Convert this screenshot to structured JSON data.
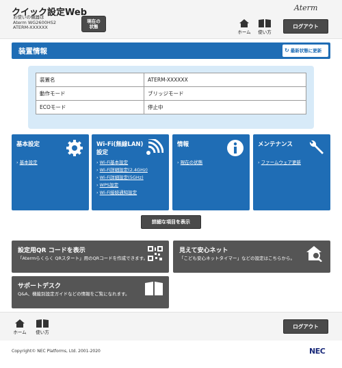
{
  "header": {
    "title": "クイック設定Web",
    "device_label": "お使いの機器は",
    "device_model": "Aterm WG2600HS2",
    "device_name": "ATERM-XXXXXX",
    "status_button": "現在の\n状態",
    "home_label": "ホーム",
    "manual_label": "使い方",
    "brand_logo": "Aterm",
    "logout_label": "ログアウト"
  },
  "section": {
    "title": "装置情報",
    "refresh_label": "最新状態に更新",
    "refresh_icon": "refresh-icon"
  },
  "device_info": {
    "rows": [
      {
        "key": "装置名",
        "value": "ATERM-XXXXXX"
      },
      {
        "key": "動作モード",
        "value": "ブリッジモード"
      },
      {
        "key": "ECOモード",
        "value": "停止中"
      }
    ]
  },
  "tiles": [
    {
      "title": "基本設定",
      "icon": "gear-icon",
      "links": [
        "基本設定"
      ]
    },
    {
      "title": "Wi-Fi(無線LAN)\n設定",
      "icon": "wifi-icon",
      "links": [
        "Wi-Fi基本設定",
        "Wi-Fi詳細設定(2.4GHz)",
        "Wi-Fi詳細設定(5GHz)",
        "WPS設定",
        "Wi-Fi接続通知設定"
      ]
    },
    {
      "title": "情報",
      "icon": "info-icon",
      "links": [
        "現在の状態"
      ]
    },
    {
      "title": "メンテナンス",
      "icon": "wrench-icon",
      "links": [
        "ファームウェア更新"
      ]
    }
  ],
  "detail_button": "詳細な項目を表示",
  "features": [
    {
      "title": "設定用QR コードを表示",
      "desc": "「Atermらくらく QRスタート」用のQRコードを作成できます。",
      "icon": "qr-code-icon"
    },
    {
      "title": "見えて安心ネット",
      "desc": "「こども安心ネットタイマー」などの設定はこちらから。",
      "icon": "home-search-icon"
    },
    {
      "title": "サポートデスク",
      "desc": "Q&A、機能別設定ガイドなどの情報をご覧になれます。",
      "icon": "book-icon"
    }
  ],
  "footer": {
    "home_label": "ホーム",
    "manual_label": "使い方",
    "logout_label": "ログアウト",
    "copyright": "Copyright© NEC Platforms, Ltd. 2001-2020",
    "company_logo": "NEC"
  },
  "colors": {
    "primary_blue": "#1f6db5",
    "panel_light_blue": "#d7eaf8",
    "dark_button": "#4a4a4a",
    "feature_gray": "#555555"
  }
}
